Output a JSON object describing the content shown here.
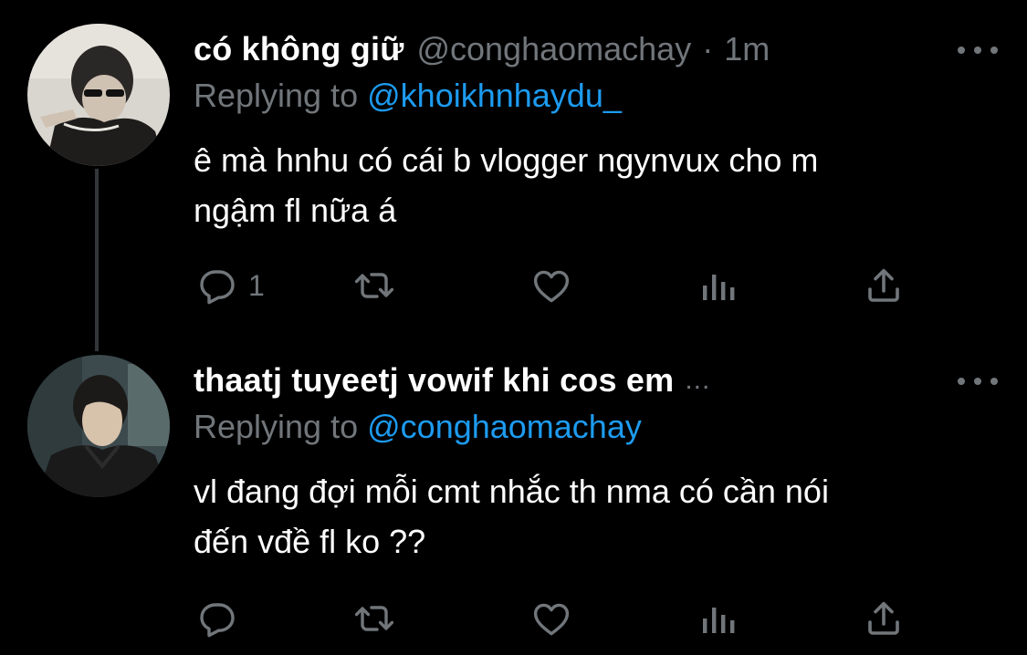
{
  "colors": {
    "background": "#000000",
    "primary_text": "#ffffff",
    "secondary_text": "#71767b",
    "link": "#1d9bf0",
    "thread_line": "#333639"
  },
  "tweets": [
    {
      "display_name": "có không giữ",
      "handle": "@conghaomachay",
      "separator": "·",
      "time": "1m",
      "replying_prefix": "Replying to",
      "replying_to": "@khoikhnhaydu_",
      "text_lines": [
        "ê mà hnhu có cái b vlogger ngynvux cho m",
        "ngậm fl nữa á"
      ],
      "reply_count": "1"
    },
    {
      "display_name": "thaatj tuyeetj vowif khi cos em",
      "name_truncation": "...",
      "replying_prefix": "Replying to",
      "replying_to": "@conghaomachay",
      "text_lines": [
        "vl đang đợi mỗi cmt nhắc th nma có cần nói",
        "đến vđề fl ko ??"
      ],
      "reply_count": ""
    }
  ],
  "icons": {
    "reply": "reply-icon",
    "retweet": "retweet-icon",
    "like": "heart-icon",
    "views": "views-icon",
    "share": "share-icon",
    "more": "more-options-icon"
  }
}
